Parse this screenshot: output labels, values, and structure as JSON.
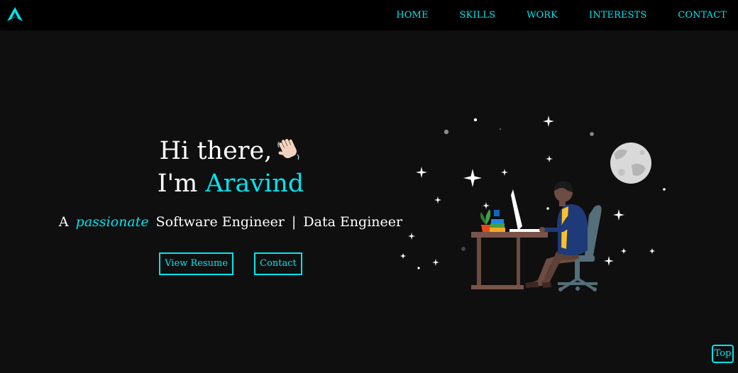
{
  "nav": {
    "links": [
      "HOME",
      "SKILLS",
      "WORK",
      "INTERESTS",
      "CONTACT"
    ]
  },
  "hero": {
    "greeting": "Hi there,",
    "intro": "I'm",
    "name": "Aravind",
    "tagline_prefix": "A",
    "tagline_emphasis": "passionate",
    "role_1": "Software Engineer",
    "separator": "|",
    "role_2": "Data Engineer"
  },
  "buttons": {
    "resume": "View Resume",
    "contact": "Contact"
  },
  "top_button": "Top",
  "colors": {
    "accent": "#00e5ee",
    "background": "#0f0f0f",
    "navbar": "#000000",
    "text": "#ffffff"
  },
  "icons": {
    "logo": "triangle-a-logo",
    "wave": "waving-hand-icon"
  }
}
